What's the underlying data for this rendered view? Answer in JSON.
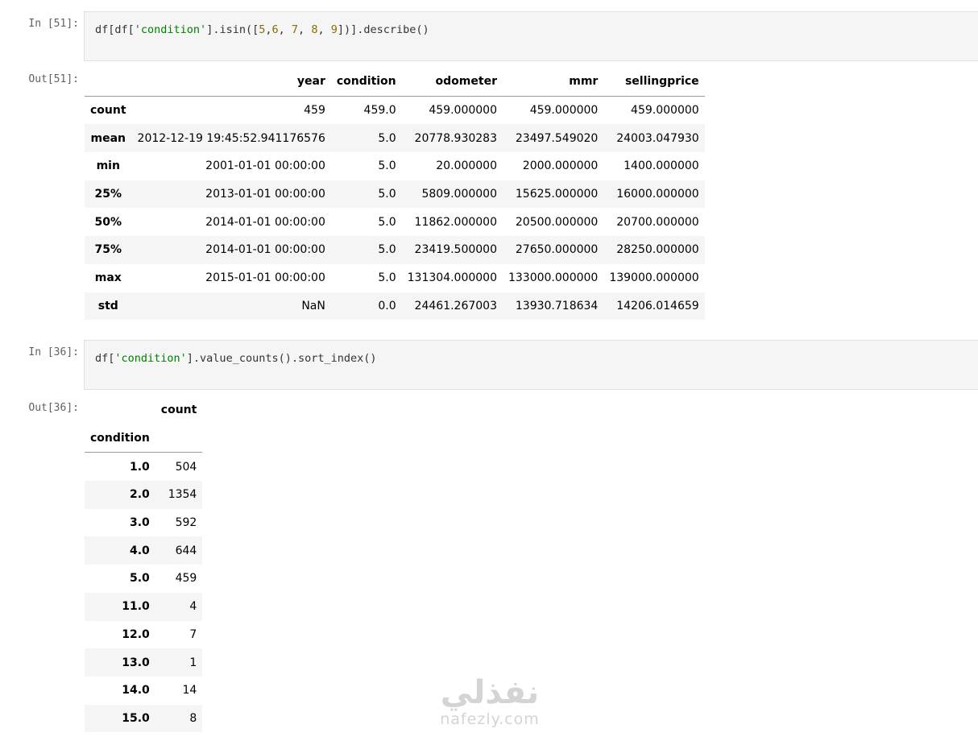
{
  "cell1": {
    "in_prompt": "In [51]:",
    "code": {
      "p1": "df[df[",
      "s1": "'condition'",
      "p2": "].isin([",
      "n1": "5",
      "c1": ",",
      "n2": "6",
      "c2": ", ",
      "n3": "7",
      "c3": ", ",
      "n4": "8",
      "c4": ", ",
      "n5": "9",
      "p3": "])].describe()"
    },
    "out_prompt": "Out[51]:",
    "table": {
      "columns": [
        "year",
        "condition",
        "odometer",
        "mmr",
        "sellingprice"
      ],
      "rows": [
        {
          "index": "count",
          "values": [
            "459",
            "459.0",
            "459.000000",
            "459.000000",
            "459.000000"
          ]
        },
        {
          "index": "mean",
          "values": [
            "2012-12-19 19:45:52.941176576",
            "5.0",
            "20778.930283",
            "23497.549020",
            "24003.047930"
          ]
        },
        {
          "index": "min",
          "values": [
            "2001-01-01 00:00:00",
            "5.0",
            "20.000000",
            "2000.000000",
            "1400.000000"
          ]
        },
        {
          "index": "25%",
          "values": [
            "2013-01-01 00:00:00",
            "5.0",
            "5809.000000",
            "15625.000000",
            "16000.000000"
          ]
        },
        {
          "index": "50%",
          "values": [
            "2014-01-01 00:00:00",
            "5.0",
            "11862.000000",
            "20500.000000",
            "20700.000000"
          ]
        },
        {
          "index": "75%",
          "values": [
            "2014-01-01 00:00:00",
            "5.0",
            "23419.500000",
            "27650.000000",
            "28250.000000"
          ]
        },
        {
          "index": "max",
          "values": [
            "2015-01-01 00:00:00",
            "5.0",
            "131304.000000",
            "133000.000000",
            "139000.000000"
          ]
        },
        {
          "index": "std",
          "values": [
            "NaN",
            "0.0",
            "24461.267003",
            "13930.718634",
            "14206.014659"
          ]
        }
      ]
    }
  },
  "cell2": {
    "in_prompt": "In [36]:",
    "code": {
      "p1": "df[",
      "s1": "'condition'",
      "p2": "].value_counts().sort_index()"
    },
    "out_prompt": "Out[36]:",
    "table": {
      "column": "count",
      "index_name": "condition",
      "rows": [
        {
          "index": "1.0",
          "value": "504"
        },
        {
          "index": "2.0",
          "value": "1354"
        },
        {
          "index": "3.0",
          "value": "592"
        },
        {
          "index": "4.0",
          "value": "644"
        },
        {
          "index": "5.0",
          "value": "459"
        },
        {
          "index": "11.0",
          "value": "4"
        },
        {
          "index": "12.0",
          "value": "7"
        },
        {
          "index": "13.0",
          "value": "1"
        },
        {
          "index": "14.0",
          "value": "14"
        },
        {
          "index": "15.0",
          "value": "8"
        }
      ]
    }
  },
  "watermark": {
    "arabic": "نفذلي",
    "latin": "nafezly.com"
  },
  "colors": {
    "string": "#008000",
    "number": "#8a6d00",
    "prompt": "#616161",
    "cell_bg": "#f5f5f5"
  }
}
